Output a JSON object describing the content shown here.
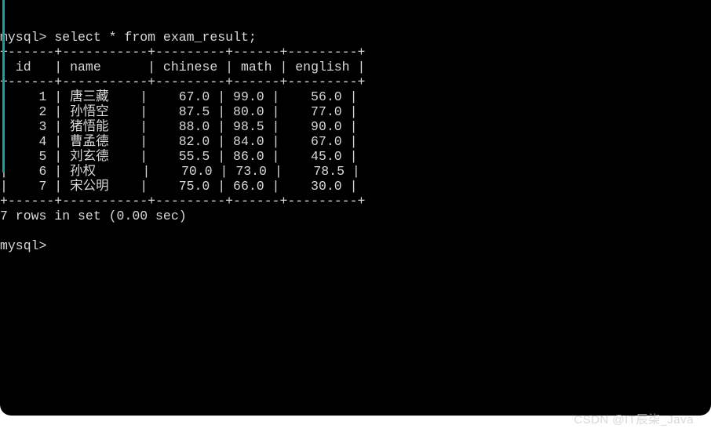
{
  "prompt1": "mysql> ",
  "query": "select * from exam_result;",
  "sep": "+------+-----------+---------+------+---------+",
  "header_line": "| id   | name      | chinese | math | english |",
  "rows_raw": [
    "|    1 | 唐三藏    |    67.0 | 99.0 |    56.0 |",
    "|    2 | 孙悟空    |    87.5 | 80.0 |    77.0 |",
    "|    3 | 猪悟能    |    88.0 | 98.5 |    90.0 |",
    "|    4 | 曹孟德    |    82.0 | 84.0 |    67.0 |",
    "|    5 | 刘玄德    |    55.5 | 86.0 |    45.0 |",
    "|    6 | 孙权      |    70.0 | 73.0 |    78.5 |",
    "|    7 | 宋公明    |    75.0 | 66.0 |    30.0 |"
  ],
  "summary": "7 rows in set (0.00 sec)",
  "prompt2": "mysql> ",
  "chart_data": {
    "type": "table",
    "columns": [
      "id",
      "name",
      "chinese",
      "math",
      "english"
    ],
    "rows": [
      [
        1,
        "唐三藏",
        67.0,
        99.0,
        56.0
      ],
      [
        2,
        "孙悟空",
        87.5,
        80.0,
        77.0
      ],
      [
        3,
        "猪悟能",
        88.0,
        98.5,
        90.0
      ],
      [
        4,
        "曹孟德",
        82.0,
        84.0,
        67.0
      ],
      [
        5,
        "刘玄德",
        55.5,
        86.0,
        45.0
      ],
      [
        6,
        "孙权",
        70.0,
        73.0,
        78.5
      ],
      [
        7,
        "宋公明",
        75.0,
        66.0,
        30.0
      ]
    ]
  },
  "watermark": "CSDN @IT辰柒_Java"
}
